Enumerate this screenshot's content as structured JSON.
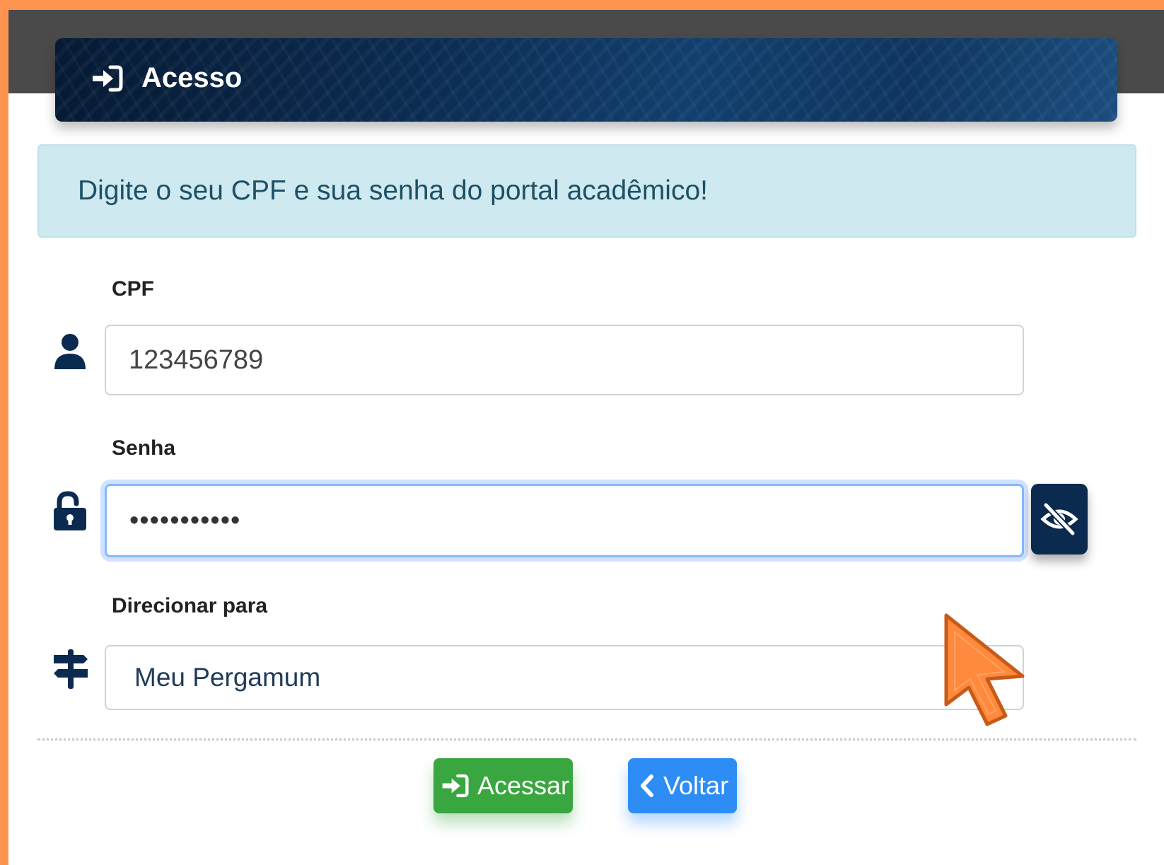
{
  "header": {
    "title": "Acesso",
    "icon": "sign-in-icon"
  },
  "alert": {
    "message": "Digite o seu CPF e sua senha do portal acadêmico!"
  },
  "form": {
    "cpf": {
      "label": "CPF",
      "value": "123456789",
      "icon": "user-icon"
    },
    "senha": {
      "label": "Senha",
      "value": "•••••••••••",
      "icon": "unlock-icon",
      "toggle_icon": "eye-slash-icon"
    },
    "redirect": {
      "label": "Direcionar para",
      "selected": "Meu Pergamum",
      "icon": "signpost-icon"
    }
  },
  "buttons": {
    "access_label": "Acessar",
    "access_icon": "sign-in-icon",
    "back_label": "Voltar",
    "back_icon": "chevron-left-icon"
  },
  "colors": {
    "page_border": "#ff9450",
    "header_bg": "#0b2c52",
    "alert_bg": "#cfe9f1",
    "alert_text": "#1e5166",
    "primary_dark": "#0b2a4f",
    "access_button": "#3aa640",
    "back_button": "#2e8df5",
    "cursor": "#ff8a3d"
  }
}
